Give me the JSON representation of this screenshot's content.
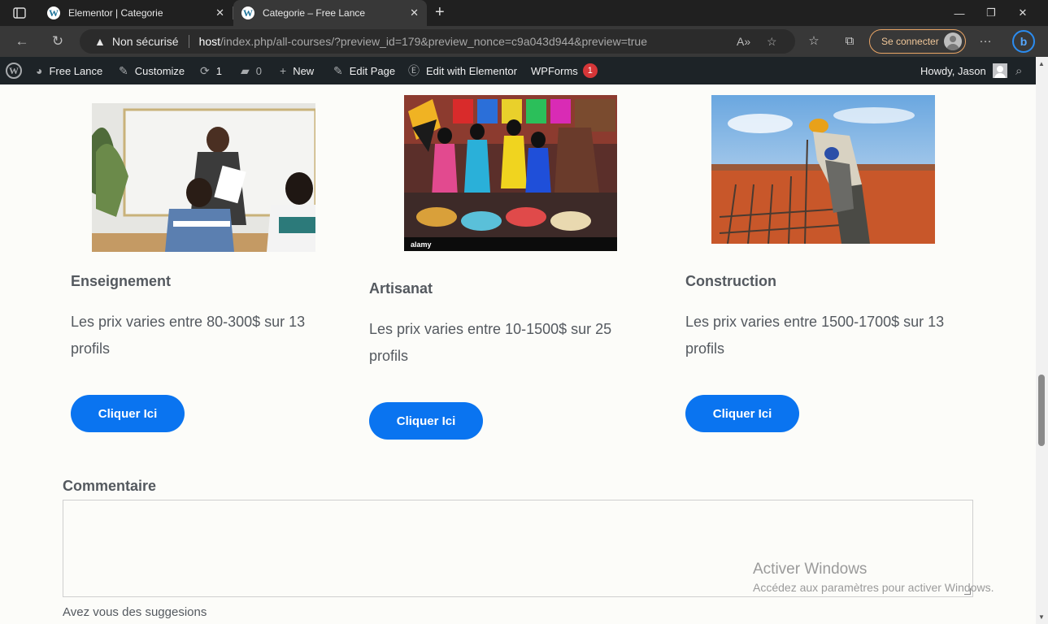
{
  "browser": {
    "tabs": [
      {
        "title": "Elementor | Categorie",
        "active": false
      },
      {
        "title": "Categorie – Free Lance",
        "active": true
      }
    ],
    "address": {
      "security_label": "Non sécurisé",
      "host": "host",
      "path": "/index.php/all-courses/?preview_id=179&preview_nonce=c9a043d944&preview=true"
    },
    "signin_label": "Se connecter"
  },
  "admin_bar": {
    "site_name": "Free Lance",
    "customize": "Customize",
    "updates_count": "1",
    "comments_count": "0",
    "new": "New",
    "edit_page": "Edit Page",
    "edit_elementor": "Edit with Elementor",
    "wpforms": "WPForms",
    "wpforms_badge": "1",
    "howdy": "Howdy, Jason"
  },
  "categories": [
    {
      "title": "Enseignement",
      "desc": "Les prix varies entre 80-300$ sur 13 profils",
      "button": "Cliquer Ici"
    },
    {
      "title": "Artisanat",
      "desc": "Les prix varies entre 10-1500$ sur 25 profils",
      "button": "Cliquer Ici"
    },
    {
      "title": "Construction",
      "desc": "Les prix varies entre 1500-1700$ sur 13 profils",
      "button": "Cliquer Ici"
    }
  ],
  "comment": {
    "label": "Commentaire",
    "help": "Avez vous des suggesions"
  },
  "watermark": {
    "title": "Activer Windows",
    "subtitle": "Accédez aux paramètres pour activer Windows."
  },
  "colors": {
    "accent": "#0a74f0",
    "text": "#54595f",
    "admin_bar": "#1d2327"
  }
}
